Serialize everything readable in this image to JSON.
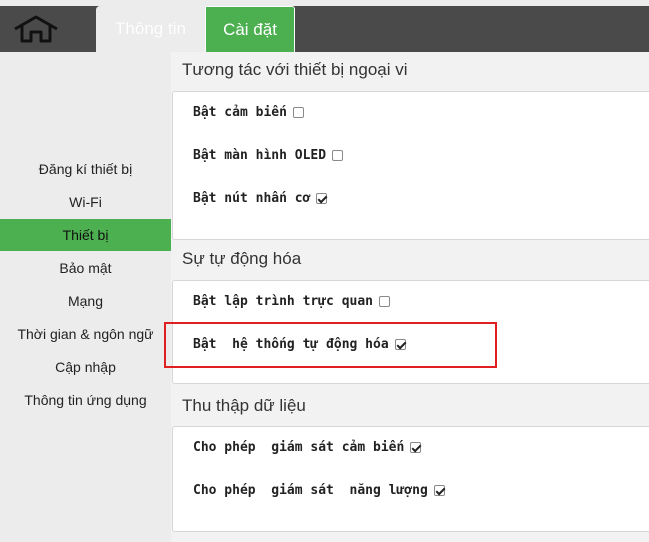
{
  "header": {
    "home_icon": "home-icon",
    "tabs": [
      {
        "label": "Thông tin"
      },
      {
        "label": "Cài đặt"
      }
    ]
  },
  "sidebar": {
    "items": [
      {
        "label": "Đăng kí thiết bị"
      },
      {
        "label": "Wi-Fi"
      },
      {
        "label": "Thiết bị"
      },
      {
        "label": "Bảo mật"
      },
      {
        "label": "Mạng"
      },
      {
        "label": "Thời gian & ngôn ngữ"
      },
      {
        "label": "Cập nhập"
      },
      {
        "label": "Thông tin ứng dụng"
      }
    ],
    "active_color": "#4caf50"
  },
  "sections": [
    {
      "title": "Tương tác với thiết bị ngoại vi",
      "options": [
        {
          "label": "Bật cảm biến",
          "checked": false
        },
        {
          "label": "Bật màn hình OLED",
          "checked": false
        },
        {
          "label": "Bật nút nhấn cơ",
          "checked": true
        }
      ]
    },
    {
      "title": "Sự tự động hóa",
      "options": [
        {
          "label": "Bật lập trình trực quan",
          "checked": false
        },
        {
          "label": "Bật  hệ thống tự động hóa",
          "checked": true
        }
      ]
    },
    {
      "title": "Thu thập dữ liệu",
      "options": [
        {
          "label": "Cho phép  giám sát cảm biến",
          "checked": true
        },
        {
          "label": "Cho phép  giám sát  năng lượng",
          "checked": true
        }
      ]
    }
  ],
  "colors": {
    "topbar": "#4a4a4a",
    "accent": "#4caf50",
    "highlight": "#e02020"
  }
}
